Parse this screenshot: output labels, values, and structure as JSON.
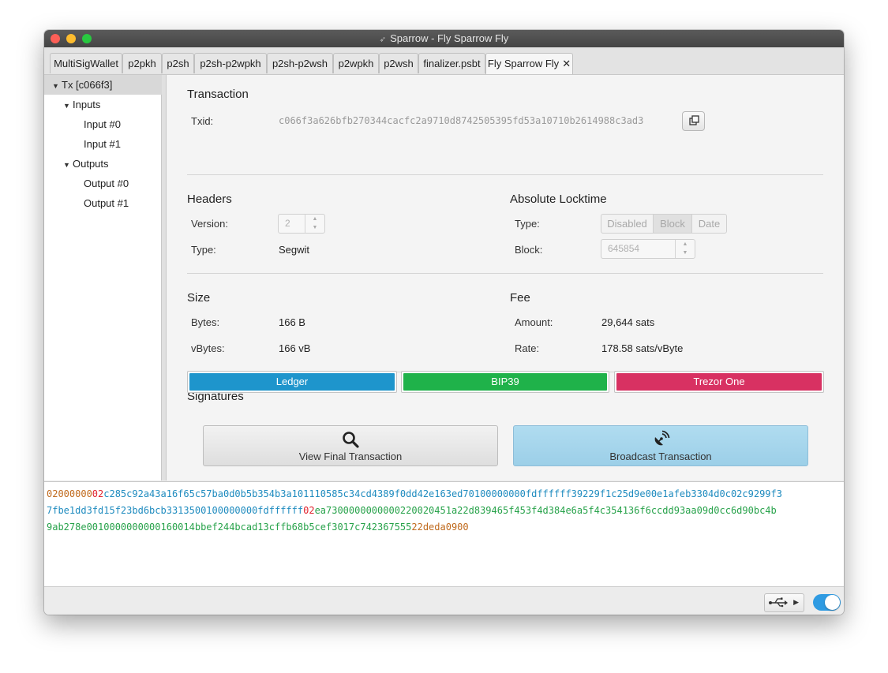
{
  "window": {
    "title": "Sparrow - Fly Sparrow Fly"
  },
  "tabs": [
    {
      "label": "MultiSigWallet"
    },
    {
      "label": "p2pkh"
    },
    {
      "label": "p2sh"
    },
    {
      "label": "p2sh-p2wpkh"
    },
    {
      "label": "p2sh-p2wsh"
    },
    {
      "label": "p2wpkh"
    },
    {
      "label": "p2wsh"
    },
    {
      "label": "finalizer.psbt"
    },
    {
      "label": "Fly Sparrow Fly",
      "close": "✕",
      "active": true
    }
  ],
  "tree": {
    "root": "Tx [c066f3]",
    "inputs": "Inputs",
    "input0": "Input #0",
    "input1": "Input #1",
    "outputs": "Outputs",
    "output0": "Output #0",
    "output1": "Output #1"
  },
  "transaction": {
    "title": "Transaction",
    "txid_label": "Txid:",
    "txid": "c066f3a626bfb270344cacfc2a9710d8742505395fd53a10710b2614988c3ad3"
  },
  "headers": {
    "title": "Headers",
    "version_label": "Version:",
    "version": "2",
    "type_label": "Type:",
    "type": "Segwit"
  },
  "locktime": {
    "title": "Absolute Locktime",
    "type_label": "Type:",
    "options": [
      "Disabled",
      "Block",
      "Date"
    ],
    "selected": "Block",
    "block_label": "Block:",
    "block": "645854"
  },
  "size": {
    "title": "Size",
    "bytes_label": "Bytes:",
    "bytes": "166 B",
    "vbytes_label": "vBytes:",
    "vbytes": "166 vB"
  },
  "fee": {
    "title": "Fee",
    "amount_label": "Amount:",
    "amount": "29,644 sats",
    "rate_label": "Rate:",
    "rate": "178.58 sats/vByte"
  },
  "signatures": {
    "title": "Signatures",
    "signers": [
      {
        "name": "Ledger",
        "color": "#1e95cc"
      },
      {
        "name": "BIP39",
        "color": "#1fb24a"
      },
      {
        "name": "Trezor One",
        "color": "#d83162"
      }
    ]
  },
  "actions": {
    "view": {
      "label": "View Final Transaction",
      "icon": "search-icon"
    },
    "broadcast": {
      "label": "Broadcast Transaction",
      "icon": "satellite-icon"
    }
  },
  "hex": {
    "line1": [
      {
        "text": "02000000",
        "color": "#c06a1d"
      },
      {
        "text": "02",
        "color": "#e0232e"
      },
      {
        "text": "c285c92a43a16f65c57ba0d0b5b354b3a101110585c34cd4389f0dd42e163ed70100000000fdffffff39229f1c25d9e00e1afeb3304d0c02c9299f3",
        "color": "#1e8bbf"
      }
    ],
    "line2": [
      {
        "text": "7fbe1dd3fd15f23bd6bcb3313500100000000fdffffff",
        "color": "#1e8bbf"
      },
      {
        "text": "02",
        "color": "#e0232e"
      },
      {
        "text": "ea7300000000000220020451a22d839465f453f4d384e6a5f4c354136f6ccdd93aa09d0cc6d90bc4b",
        "color": "#27a24a"
      }
    ],
    "line3": [
      {
        "text": "9ab278e0010000000000160014bbef244bcad13cffb68b5cef3017c742367555",
        "color": "#27a24a"
      },
      {
        "text": "22deda0900",
        "color": "#c06a1d"
      }
    ]
  },
  "statusbar": {
    "usb_icon": "usb-icon",
    "toggle": "on"
  }
}
